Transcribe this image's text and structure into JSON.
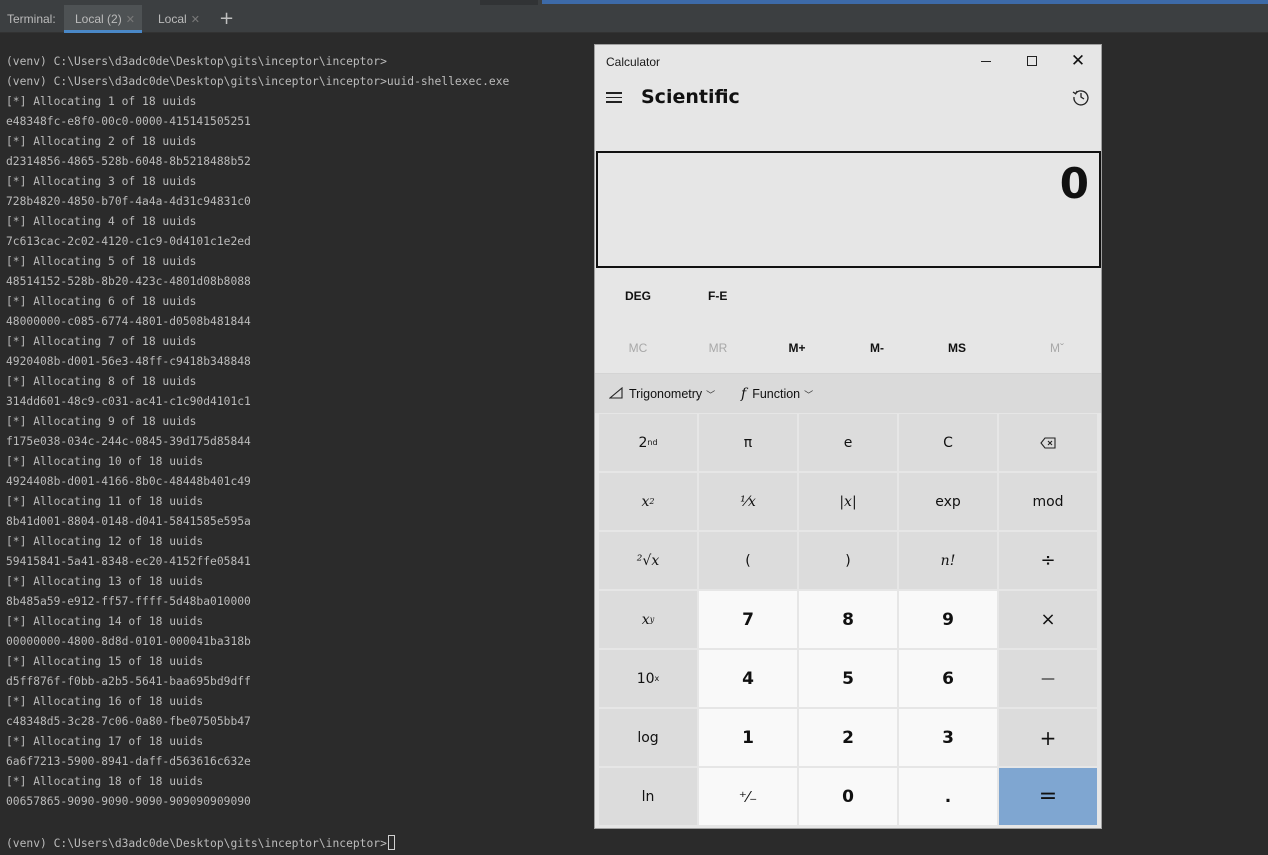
{
  "tabbar": {
    "label": "Terminal:",
    "tabs": [
      {
        "label": "Local (2)",
        "active": true
      },
      {
        "label": "Local",
        "active": false
      }
    ],
    "add_icon": "plus-icon",
    "close_icon": "x-icon"
  },
  "terminal": {
    "lines": [
      "(venv) C:\\Users\\d3adc0de\\Desktop\\gits\\inceptor\\inceptor>",
      "(venv) C:\\Users\\d3adc0de\\Desktop\\gits\\inceptor\\inceptor>uuid-shellexec.exe",
      "[*] Allocating 1 of 18 uuids",
      "e48348fc-e8f0-00c0-0000-415141505251",
      "[*] Allocating 2 of 18 uuids",
      "d2314856-4865-528b-6048-8b5218488b52",
      "[*] Allocating 3 of 18 uuids",
      "728b4820-4850-b70f-4a4a-4d31c94831c0",
      "[*] Allocating 4 of 18 uuids",
      "7c613cac-2c02-4120-c1c9-0d4101c1e2ed",
      "[*] Allocating 5 of 18 uuids",
      "48514152-528b-8b20-423c-4801d08b8088",
      "[*] Allocating 6 of 18 uuids",
      "48000000-c085-6774-4801-d0508b481844",
      "[*] Allocating 7 of 18 uuids",
      "4920408b-d001-56e3-48ff-c9418b348848",
      "[*] Allocating 8 of 18 uuids",
      "314dd601-48c9-c031-ac41-c1c90d4101c1",
      "[*] Allocating 9 of 18 uuids",
      "f175e038-034c-244c-0845-39d175d85844",
      "[*] Allocating 10 of 18 uuids",
      "4924408b-d001-4166-8b0c-48448b401c49",
      "[*] Allocating 11 of 18 uuids",
      "8b41d001-8804-0148-d041-5841585e595a",
      "[*] Allocating 12 of 18 uuids",
      "59415841-5a41-8348-ec20-4152ffe05841",
      "[*] Allocating 13 of 18 uuids",
      "8b485a59-e912-ff57-ffff-5d48ba010000",
      "[*] Allocating 14 of 18 uuids",
      "00000000-4800-8d8d-0101-000041ba318b",
      "[*] Allocating 15 of 18 uuids",
      "d5ff876f-f0bb-a2b5-5641-baa695bd9dff",
      "[*] Allocating 16 of 18 uuids",
      "c48348d5-3c28-7c06-0a80-fbe07505bb47",
      "[*] Allocating 17 of 18 uuids",
      "6a6f7213-5900-8941-daff-d563616c632e",
      "[*] Allocating 18 of 18 uuids",
      "00657865-9090-9090-9090-909090909090"
    ],
    "prompt": "(venv) C:\\Users\\d3adc0de\\Desktop\\gits\\inceptor\\inceptor>"
  },
  "calculator": {
    "window_title": "Calculator",
    "mode": "Scientific",
    "display_value": "0",
    "angle_mode": "DEG",
    "fe_label": "F-E",
    "memory": [
      {
        "label": "MC",
        "enabled": false
      },
      {
        "label": "MR",
        "enabled": false
      },
      {
        "label": "M+",
        "enabled": true
      },
      {
        "label": "M-",
        "enabled": true
      },
      {
        "label": "MS",
        "enabled": true
      },
      {
        "label": "Mˇ",
        "enabled": false
      }
    ],
    "trig_label": "Trigonometry",
    "function_label": "Function",
    "keys": {
      "second": "2",
      "second_sup": "nd",
      "pi": "π",
      "e": "e",
      "clear": "C",
      "x_sq": "x",
      "x_sq_sup": "2",
      "inv": "¹⁄x",
      "abs": "|x|",
      "exp": "exp",
      "mod": "mod",
      "sqrt": "²√x",
      "lparen": "(",
      "rparen": ")",
      "fact": "n!",
      "div": "÷",
      "x_pow": "x",
      "x_pow_sup": "y",
      "n7": "7",
      "n8": "8",
      "n9": "9",
      "mul": "×",
      "ten_pow": "10",
      "ten_pow_sup": "x",
      "n4": "4",
      "n5": "5",
      "n6": "6",
      "minus": "—",
      "log": "log",
      "n1": "1",
      "n2": "2",
      "n3": "3",
      "plus": "+",
      "ln": "ln",
      "negate": "⁺⁄₋",
      "n0": "0",
      "dot": ".",
      "equals": "="
    },
    "icons": {
      "menu": "hamburger-menu-icon",
      "history": "history-icon",
      "backspace": "backspace-icon",
      "trig": "triangle-ruler-icon",
      "function": "function-icon"
    },
    "colors": {
      "equals_bg": "#7fa6d1",
      "window_bg": "#e6e6e6",
      "number_key_bg": "#f9f9f9",
      "function_key_bg": "#dcdcdc"
    }
  }
}
